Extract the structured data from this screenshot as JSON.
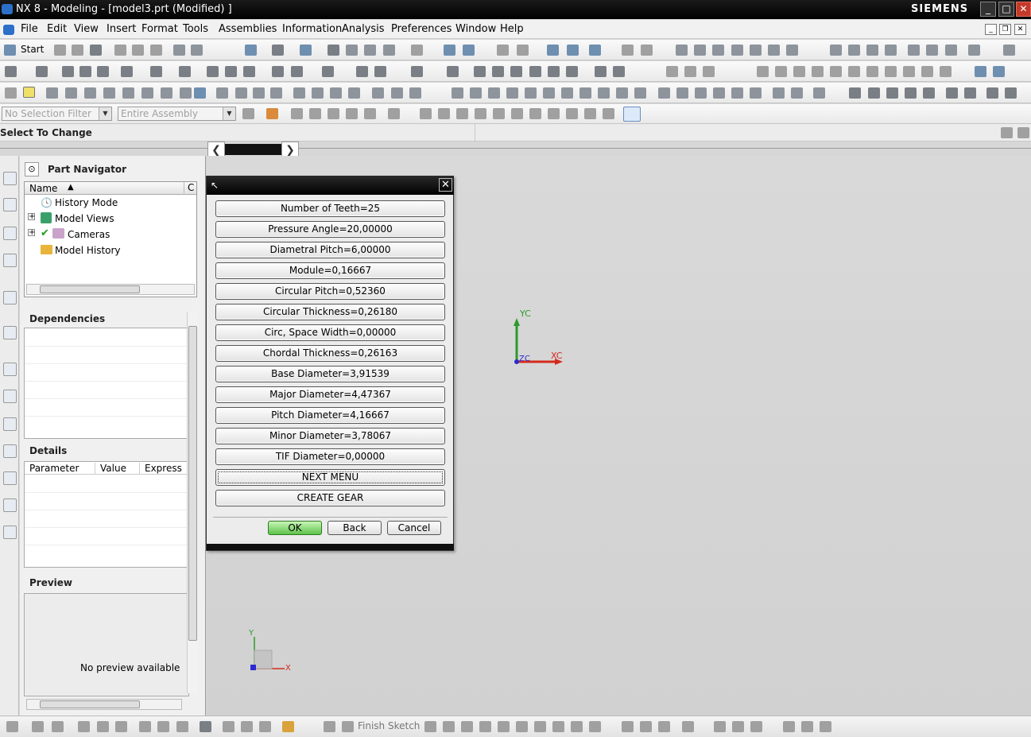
{
  "window": {
    "title": "NX 8 - Modeling - [model3.prt (Modified) ]",
    "brand": "SIEMENS"
  },
  "menu": [
    "File",
    "Edit",
    "View",
    "Insert",
    "Format",
    "Tools",
    "Assemblies",
    "Information",
    "Analysis",
    "Preferences",
    "Window",
    "Help"
  ],
  "toolbar": {
    "start_label": "Start",
    "selection_filter": "No Selection Filter",
    "assembly_scope": "Entire Assembly"
  },
  "status": {
    "prompt": "Select To Change"
  },
  "navigator": {
    "title": "Part Navigator",
    "columns": {
      "name": "Name",
      "c": "C"
    },
    "items": [
      "History Mode",
      "Model Views",
      "Cameras",
      "Model History"
    ],
    "dependencies_title": "Dependencies",
    "details_title": "Details",
    "details_columns": [
      "Parameter",
      "Value",
      "Express"
    ],
    "preview_title": "Preview",
    "preview_text": "No preview available"
  },
  "dialog": {
    "buttons": [
      "Number of Teeth=25",
      "Pressure Angle=20,00000",
      "Diametral Pitch=6,00000",
      "Module=0,16667",
      "Circular Pitch=0,52360",
      "Circular Thickness=0,26180",
      "Circ, Space Width=0,00000",
      "Chordal Thickness=0,26163",
      "Base Diameter=3,91539",
      "Major Diameter=4,47367",
      "Pitch Diameter=4,16667",
      "Minor Diameter=3,78067",
      "TIF Diameter=0,00000",
      "NEXT MENU",
      "CREATE GEAR"
    ],
    "ok": "OK",
    "back": "Back",
    "cancel": "Cancel"
  },
  "axes": {
    "yc": "YC",
    "xc": "XC",
    "zc": "ZC",
    "y": "Y",
    "x": "X"
  },
  "bottom_toolbar": {
    "finish_sketch": "Finish Sketch"
  },
  "colors": {
    "titlebar": "#000000",
    "ok_button": "#5dc24a",
    "x_axis": "#d32a1c",
    "y_axis": "#2c9a2c",
    "z_axis": "#2a2ad0"
  }
}
